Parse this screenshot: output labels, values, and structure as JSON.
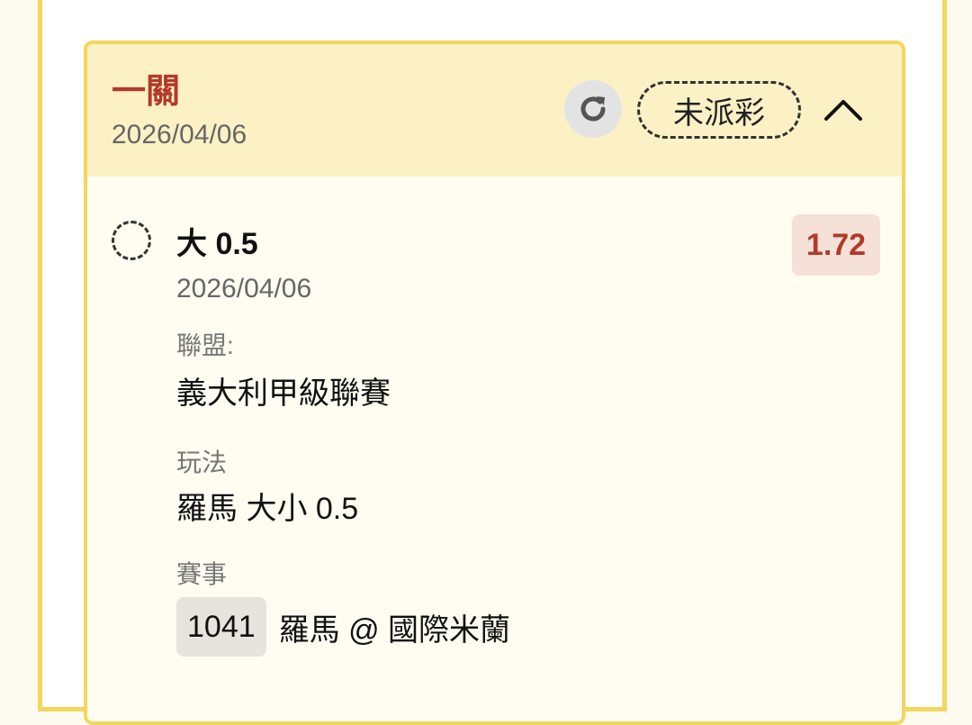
{
  "header": {
    "bet_type": "一關",
    "date": "2026/04/06",
    "status": "未派彩"
  },
  "selection": {
    "name": "大 0.5",
    "date": "2026/04/06",
    "odds": "1.72"
  },
  "details": {
    "league_label": "聯盟:",
    "league_value": "義大利甲級聯賽",
    "market_label": "玩法",
    "market_value": "羅馬 大小 0.5",
    "event_label": "賽事",
    "event_id": "1041",
    "event_name": "羅馬 @ 國際米蘭"
  },
  "icons": {
    "refresh": "refresh-icon",
    "collapse": "chevron-up-icon",
    "radio": "dashed-circle-icon"
  },
  "colors": {
    "accent_red": "#b23a2a",
    "border_yellow": "#f3d65c",
    "header_bg": "#fcf1c5",
    "odds_bg": "#f5e1d7"
  }
}
